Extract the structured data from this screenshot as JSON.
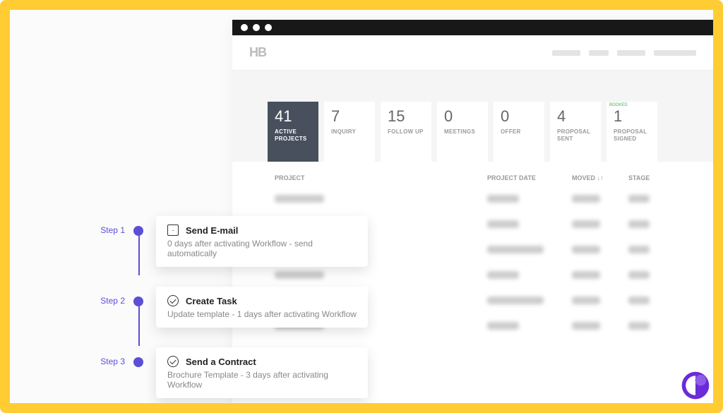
{
  "logo": "HB",
  "stats": [
    {
      "num": "41",
      "label": "ACTIVE PROJECTS",
      "active": true
    },
    {
      "num": "7",
      "label": "INQUIRY"
    },
    {
      "num": "15",
      "label": "FOLLOW UP"
    },
    {
      "num": "0",
      "label": "MEETINGS"
    },
    {
      "num": "0",
      "label": "OFFER"
    },
    {
      "num": "4",
      "label": "PROPOSAL SENT"
    },
    {
      "num": "1",
      "label": "PROPOSAL SIGNED",
      "badge": "BOOKED"
    }
  ],
  "table_headers": {
    "project": "PROJECT",
    "date": "PROJECT DATE",
    "moved": "MOVED ↓↑",
    "stage": "STAGE"
  },
  "steps": [
    {
      "label": "Step 1",
      "icon": "mail",
      "title": "Send E-mail",
      "sub": "0 days after activating Workflow - send automatically"
    },
    {
      "label": "Step 2",
      "icon": "check",
      "title": "Create Task",
      "sub": "Update template - 1 days after activating Workflow"
    },
    {
      "label": "Step 3",
      "icon": "check",
      "title": "Send a Contract",
      "sub": "Brochure Template - 3 days after activating Workflow"
    }
  ],
  "colors": {
    "accent": "#5b4fd6",
    "frame": "#ffcc33"
  }
}
